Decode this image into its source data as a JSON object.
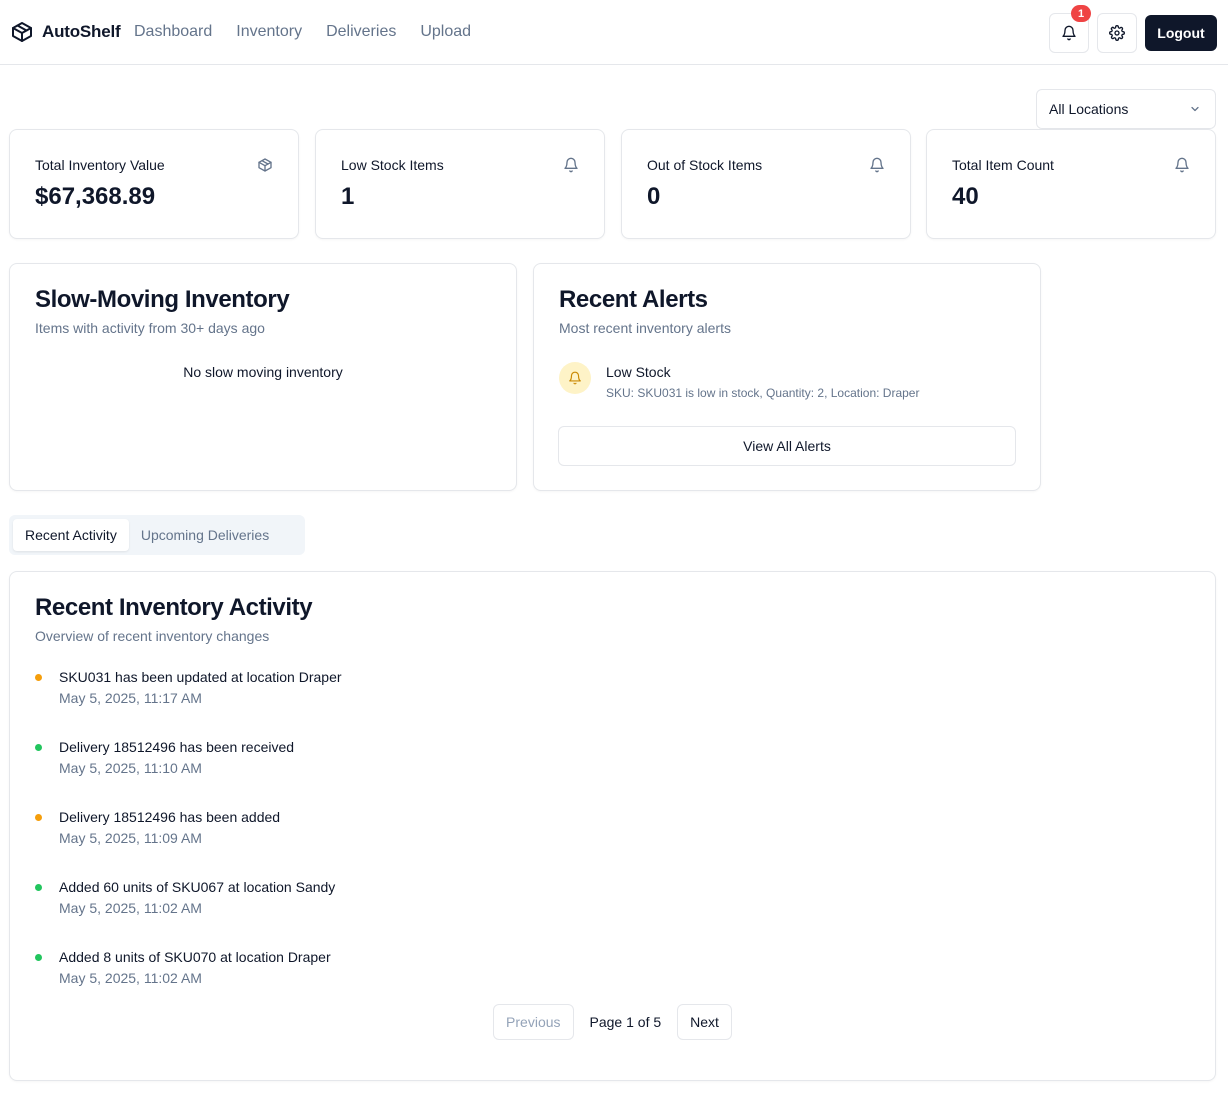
{
  "header": {
    "brand": "AutoShelf",
    "nav": [
      "Dashboard",
      "Inventory",
      "Deliveries",
      "Upload"
    ],
    "notification_count": "1",
    "logout_label": "Logout"
  },
  "filters": {
    "location_selected": "All Locations"
  },
  "stats": [
    {
      "title": "Total Inventory Value",
      "value": "$67,368.89",
      "icon": "package-icon"
    },
    {
      "title": "Low Stock Items",
      "value": "1",
      "icon": "bell-icon"
    },
    {
      "title": "Out of Stock Items",
      "value": "0",
      "icon": "bell-icon"
    },
    {
      "title": "Total Item Count",
      "value": "40",
      "icon": "bell-icon"
    }
  ],
  "slow_moving": {
    "title": "Slow-Moving Inventory",
    "subtitle": "Items with activity from 30+ days ago",
    "empty_text": "No slow moving inventory"
  },
  "alerts": {
    "title": "Recent Alerts",
    "subtitle": "Most recent inventory alerts",
    "items": [
      {
        "name": "Low Stock",
        "description": "SKU: SKU031 is low in stock, Quantity: 2, Location: Draper"
      }
    ],
    "view_all_label": "View All Alerts"
  },
  "tabs": [
    "Recent Activity",
    "Upcoming Deliveries"
  ],
  "activity": {
    "title": "Recent Inventory Activity",
    "subtitle": "Overview of recent inventory changes",
    "items": [
      {
        "text": "SKU031 has been updated at location Draper",
        "time": "May 5, 2025, 11:17 AM",
        "color": "#f59e0b"
      },
      {
        "text": "Delivery 18512496 has been received",
        "time": "May 5, 2025, 11:10 AM",
        "color": "#22c55e"
      },
      {
        "text": "Delivery 18512496 has been added",
        "time": "May 5, 2025, 11:09 AM",
        "color": "#f59e0b"
      },
      {
        "text": "Added 60 units of SKU067 at location Sandy",
        "time": "May 5, 2025, 11:02 AM",
        "color": "#22c55e"
      },
      {
        "text": "Added 8 units of SKU070 at location Draper",
        "time": "May 5, 2025, 11:02 AM",
        "color": "#22c55e"
      }
    ],
    "pagination": {
      "previous_label": "Previous",
      "page_label": "Page 1 of 5",
      "next_label": "Next"
    }
  }
}
